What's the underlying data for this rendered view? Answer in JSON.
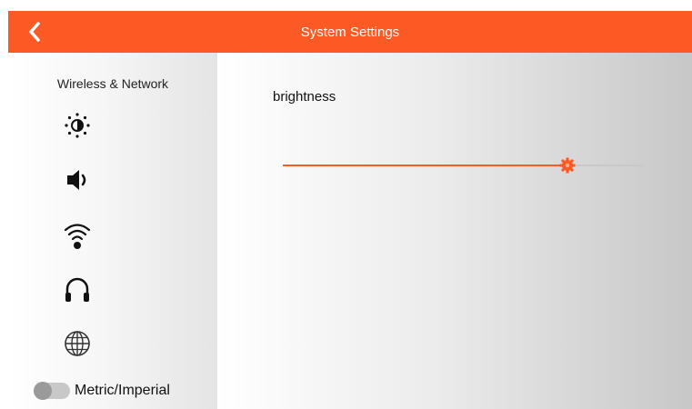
{
  "header": {
    "title": "System Settings",
    "back_icon": "chevron-left-icon"
  },
  "sidebar": {
    "heading": "Wireless & Network",
    "icons": [
      "brightness-icon",
      "volume-icon",
      "wifi-icon",
      "headphones-icon",
      "globe-icon"
    ],
    "toggle": {
      "label": "Metric/Imperial",
      "on": false
    }
  },
  "main": {
    "setting_label": "brightness",
    "slider": {
      "value_fraction": 0.79
    }
  },
  "colors": {
    "accent": "#fb5a24",
    "track": "#c9c9c9"
  }
}
